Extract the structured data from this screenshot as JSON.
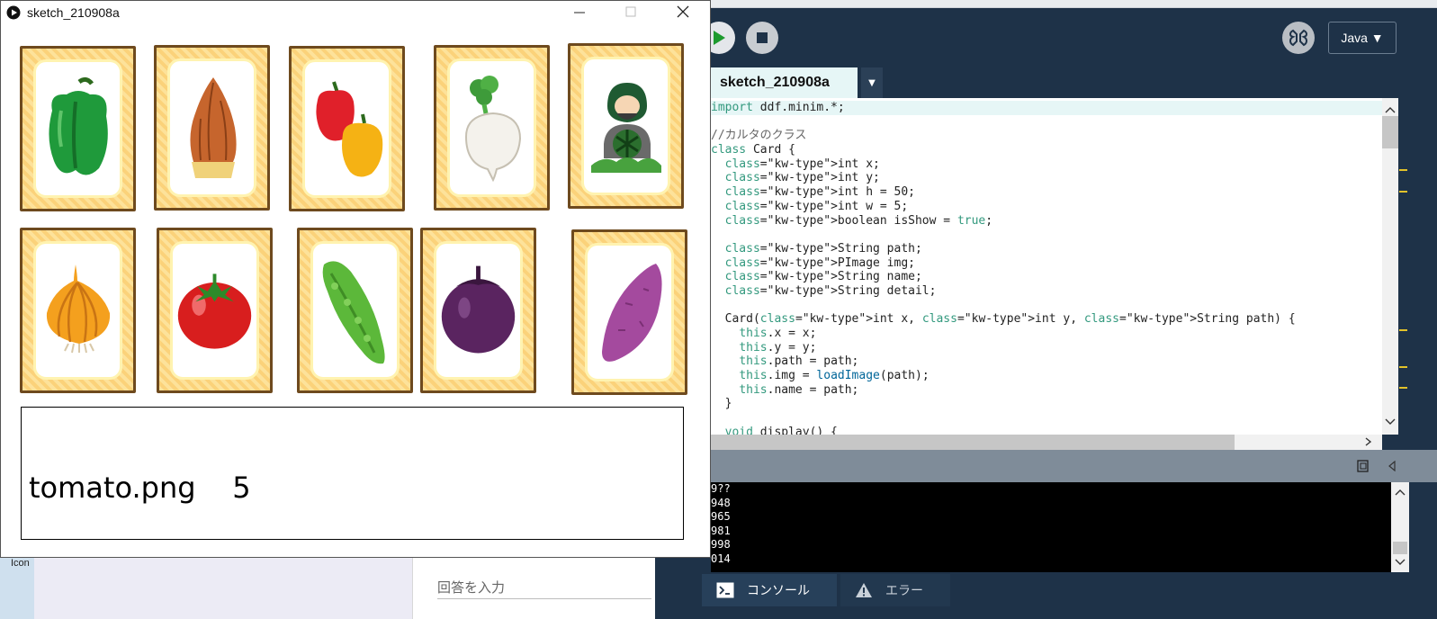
{
  "sketch_window": {
    "title": "sketch_210908a",
    "info_text": "tomato.png    5"
  },
  "cards": [
    {
      "name": "green-pepper"
    },
    {
      "name": "bamboo-shoot"
    },
    {
      "name": "bell-peppers"
    },
    {
      "name": "turnip"
    },
    {
      "name": "watermelon-farmer"
    },
    {
      "name": "onion"
    },
    {
      "name": "tomato"
    },
    {
      "name": "bitter-gourd"
    },
    {
      "name": "eggplant"
    },
    {
      "name": "sweet-potato"
    }
  ],
  "ide": {
    "mode": "Java ▼",
    "tab_title": "sketch_210908a",
    "tab_menu": "▼",
    "code_lines": [
      "import ddf.minim.*;",
      "",
      "//カルタのクラス",
      "class Card {",
      "  int x;",
      "  int y;",
      "  int h = 50;",
      "  int w = 5;",
      "  boolean isShow = true;",
      "",
      "  String path;",
      "  PImage img;",
      "  String name;",
      "  String detail;",
      "",
      "  Card(int x, int y, String path) {",
      "    this.x = x;",
      "    this.y = y;",
      "    this.path = path;",
      "    this.img = loadImage(path);",
      "    this.name = path;",
      "  }",
      "",
      "  void display() {"
    ],
    "console_lines": [
      "9??",
      "948",
      "965",
      "981",
      "998",
      "014"
    ],
    "console_tab": "コンソール",
    "error_tab": "エラー"
  },
  "desktop": {
    "icon_label": "Icon",
    "answer_placeholder": "回答を入力"
  },
  "colors": {
    "ide_background": "#1e3248",
    "card_border": "#6e4a1e",
    "card_fill": "#fde29a",
    "keyword_orange": "#e2661a",
    "keyword_green": "#33997e"
  }
}
